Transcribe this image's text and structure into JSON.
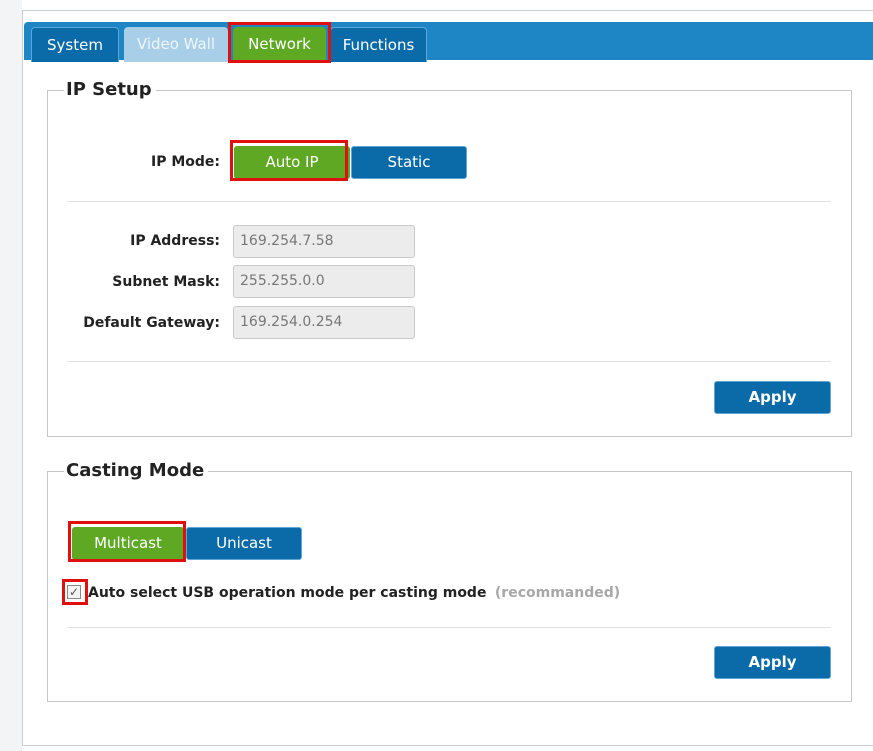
{
  "tabs": [
    {
      "label": "System"
    },
    {
      "label": "Video Wall"
    },
    {
      "label": "Network"
    },
    {
      "label": "Functions"
    }
  ],
  "ip_setup": {
    "legend": "IP Setup",
    "ip_mode_label": "IP Mode:",
    "mode_auto": "Auto IP",
    "mode_static": "Static",
    "selected_mode": "Auto IP",
    "ip_address_label": "IP Address:",
    "ip_address_value": "169.254.7.58",
    "subnet_label": "Subnet Mask:",
    "subnet_value": "255.255.0.0",
    "gateway_label": "Default Gateway:",
    "gateway_value": "169.254.0.254",
    "apply_label": "Apply"
  },
  "casting": {
    "legend": "Casting Mode",
    "multicast_label": "Multicast",
    "unicast_label": "Unicast",
    "selected_mode": "Multicast",
    "checkbox_label": "Auto select USB operation mode per casting mode",
    "checkbox_hint": "(recommanded)",
    "checkbox_checked": true,
    "apply_label": "Apply"
  },
  "colors": {
    "active": "#5ea823",
    "primary": "#0b6aa8",
    "highlight": "#e01010"
  }
}
